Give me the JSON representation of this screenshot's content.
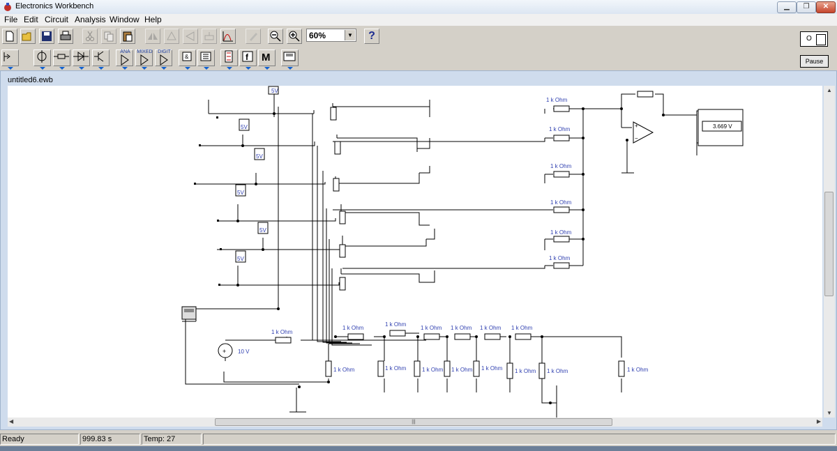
{
  "window": {
    "title": "Electronics Workbench"
  },
  "menu": [
    "File",
    "Edit",
    "Circuit",
    "Analysis",
    "Window",
    "Help"
  ],
  "toolbar": {
    "zoom": "60%",
    "help": "?",
    "parts_labels": [
      "ANA",
      "MIXED",
      "DIGIT"
    ],
    "f_label": "f",
    "m_label": "M",
    "power_label": "O",
    "pause_label": "Pause"
  },
  "document": {
    "title": "untitled6.ewb"
  },
  "circuit": {
    "resistor_label": "1 k Ohm",
    "battery_label": "5V",
    "source_label": "10 V",
    "meter_reading": "3.669 V"
  },
  "status": {
    "ready": "Ready",
    "time": "999.83 s",
    "temp": "Temp: 27"
  }
}
